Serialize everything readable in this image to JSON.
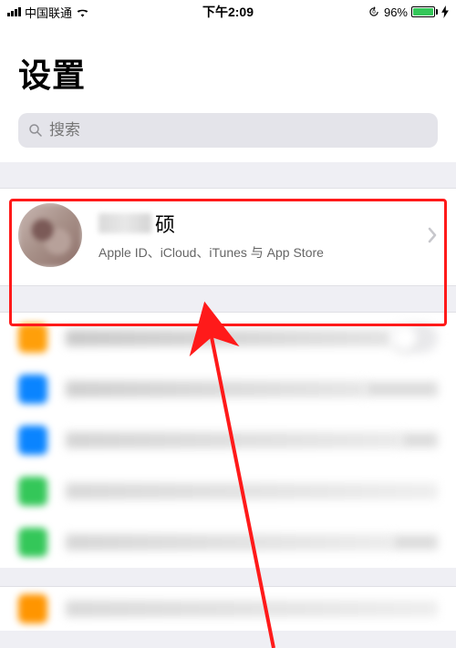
{
  "status_bar": {
    "carrier": "中国联通",
    "time": "下午2:09",
    "battery_pct": "96%"
  },
  "header": {
    "title": "设置"
  },
  "search": {
    "placeholder": "搜索"
  },
  "profile": {
    "name_suffix": "硕",
    "subtitle": "Apple ID、iCloud、iTunes 与 App Store"
  },
  "icons": {
    "row1": "#ff9f0a",
    "row2": "#0a84ff",
    "row3": "#0a84ff",
    "row4": "#34c759",
    "row5": "#34c759",
    "bottom": "#ff9500"
  }
}
